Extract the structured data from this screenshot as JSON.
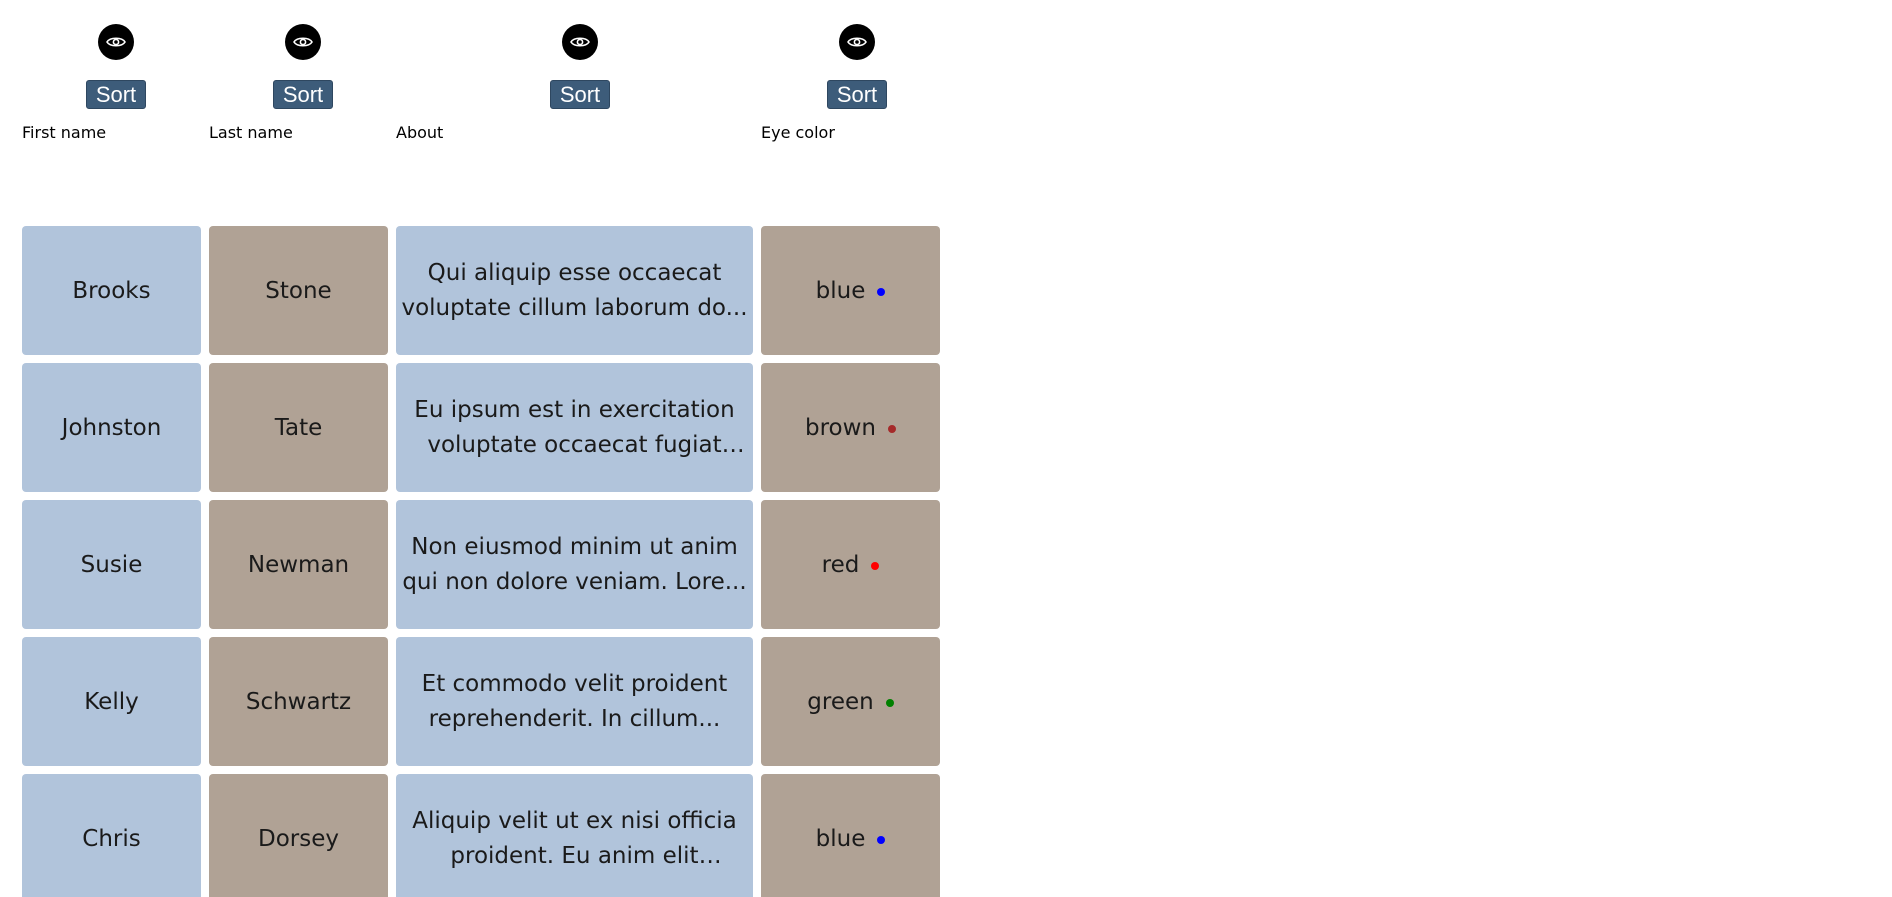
{
  "columns": [
    {
      "label": "First name",
      "sort_label": "Sort",
      "toggle_icon": "eye-icon"
    },
    {
      "label": "Last name",
      "sort_label": "Sort",
      "toggle_icon": "eye-icon"
    },
    {
      "label": "About",
      "sort_label": "Sort",
      "toggle_icon": "eye-icon"
    },
    {
      "label": "Eye color",
      "sort_label": "Sort",
      "toggle_icon": "eye-icon"
    }
  ],
  "rows": [
    {
      "first_name": "Brooks",
      "last_name": "Stone",
      "about": "Qui aliquip esse occaecat voluptate cillum laborum do...",
      "eye_color": "blue",
      "dot_color": "#0000ff"
    },
    {
      "first_name": "Johnston",
      "last_name": "Tate",
      "about": "Eu ipsum est in exercitation voluptate occaecat fugiat fugi...",
      "eye_color": "brown",
      "dot_color": "#a52a2a"
    },
    {
      "first_name": "Susie",
      "last_name": "Newman",
      "about": "Non eiusmod minim ut anim qui non dolore veniam. Lore...",
      "eye_color": "red",
      "dot_color": "#ff0000"
    },
    {
      "first_name": "Kelly",
      "last_name": "Schwartz",
      "about": "Et commodo velit proident reprehenderit. In cillum...",
      "eye_color": "green",
      "dot_color": "#008000"
    },
    {
      "first_name": "Chris",
      "last_name": "Dorsey",
      "about": "Aliquip velit ut ex nisi officia proident. Eu anim elit deseru...",
      "eye_color": "blue",
      "dot_color": "#0000ff"
    }
  ],
  "colors": {
    "header_bg": "#7396ae",
    "cell_blue": "#b1c4db",
    "cell_tan": "#b0a295",
    "sort_button": "#3d5c7a"
  }
}
